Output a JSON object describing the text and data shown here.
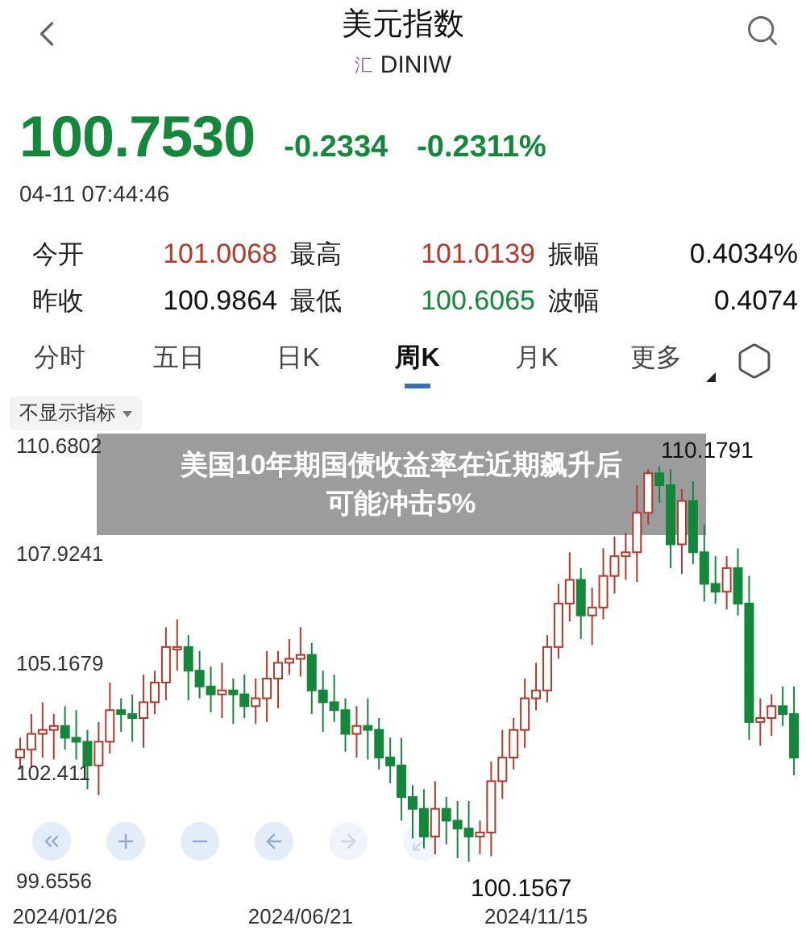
{
  "header": {
    "title": "美元指数",
    "market_tag": "汇",
    "code": "DINIW"
  },
  "quote": {
    "price": "100.7530",
    "change": "-0.2334",
    "change_pct": "-0.2311%",
    "time": "04-11 07:44:46",
    "color": "#14883a"
  },
  "stats": [
    {
      "label": "今开",
      "value": "101.0068",
      "color": "#b5382b"
    },
    {
      "label": "最高",
      "value": "101.0139",
      "color": "#b5382b"
    },
    {
      "label": "振幅",
      "value": "0.4034%",
      "color": "#111111"
    },
    {
      "label": "昨收",
      "value": "100.9864",
      "color": "#111111"
    },
    {
      "label": "最低",
      "value": "100.6065",
      "color": "#14883a"
    },
    {
      "label": "波幅",
      "value": "0.4074",
      "color": "#111111"
    }
  ],
  "tabs": [
    {
      "label": "分时",
      "selected": false
    },
    {
      "label": "五日",
      "selected": false
    },
    {
      "label": "日K",
      "selected": false
    },
    {
      "label": "周K",
      "selected": true
    },
    {
      "label": "月K",
      "selected": false
    },
    {
      "label": "更多",
      "selected": false
    }
  ],
  "indicator_selector": {
    "label": "不显示指标"
  },
  "chart": {
    "high_label": "110.1791",
    "low_label": "100.1567",
    "chart_data": {
      "type": "candlestick",
      "ylim": [
        99.6556,
        110.6802
      ],
      "yticks": [
        {
          "value": 110.6802,
          "label": "110.6802"
        },
        {
          "value": 107.9241,
          "label": "107.9241"
        },
        {
          "value": 105.1679,
          "label": "105.1679"
        },
        {
          "value": 102.411,
          "label": "102.411"
        },
        {
          "value": 99.6556,
          "label": "99.6556"
        }
      ],
      "categories": [
        null,
        null,
        null,
        null,
        "2024/01/26",
        null,
        null,
        null,
        null,
        null,
        null,
        null,
        null,
        null,
        null,
        null,
        null,
        null,
        null,
        null,
        null,
        null,
        null,
        null,
        null,
        "2024/06/21",
        null,
        null,
        null,
        null,
        null,
        null,
        null,
        null,
        null,
        null,
        null,
        null,
        null,
        null,
        null,
        null,
        null,
        null,
        null,
        null,
        "2024/11/15",
        null,
        null,
        null,
        null,
        null,
        null,
        null,
        null,
        null,
        null,
        null,
        null,
        null,
        null,
        null,
        null,
        null,
        null,
        null,
        null,
        null,
        null,
        null
      ],
      "ohlc": [
        [
          102.8,
          103.3,
          102.5,
          103.0
        ],
        [
          103.0,
          103.9,
          102.55,
          103.4
        ],
        [
          103.4,
          104.2,
          102.8,
          103.5
        ],
        [
          103.5,
          103.9,
          102.75,
          103.6
        ],
        [
          103.6,
          104.1,
          103.0,
          103.3
        ],
        [
          103.3,
          104.0,
          102.75,
          103.2
        ],
        [
          103.2,
          103.5,
          102.0,
          102.6
        ],
        [
          102.6,
          103.7,
          101.85,
          103.2
        ],
        [
          103.2,
          104.7,
          102.9,
          104.0
        ],
        [
          104.0,
          104.3,
          103.45,
          103.9
        ],
        [
          103.9,
          104.4,
          103.2,
          103.8
        ],
        [
          103.8,
          104.9,
          103.05,
          104.2
        ],
        [
          104.2,
          105.0,
          103.9,
          104.7
        ],
        [
          104.7,
          106.1,
          104.25,
          105.6
        ],
        [
          105.6,
          106.3,
          105.0,
          105.6
        ],
        [
          105.6,
          105.9,
          104.25,
          105.0
        ],
        [
          105.0,
          105.5,
          104.3,
          104.6
        ],
        [
          104.6,
          105.1,
          103.95,
          104.4
        ],
        [
          104.4,
          105.2,
          103.8,
          104.5
        ],
        [
          104.5,
          104.8,
          103.65,
          104.4
        ],
        [
          104.4,
          104.9,
          103.8,
          104.1
        ],
        [
          104.1,
          104.8,
          103.65,
          104.3
        ],
        [
          104.3,
          105.5,
          103.7,
          104.8
        ],
        [
          104.8,
          105.5,
          104.05,
          105.2
        ],
        [
          105.2,
          105.8,
          104.9,
          105.3
        ],
        [
          105.3,
          106.1,
          104.85,
          105.4
        ],
        [
          105.4,
          105.7,
          103.9,
          104.5
        ],
        [
          104.5,
          105.0,
          103.45,
          104.2
        ],
        [
          104.2,
          104.9,
          103.7,
          104.0
        ],
        [
          104.0,
          104.3,
          102.95,
          103.4
        ],
        [
          103.4,
          104.1,
          102.8,
          103.6
        ],
        [
          103.6,
          104.3,
          102.75,
          103.5
        ],
        [
          103.5,
          103.8,
          102.5,
          102.8
        ],
        [
          102.8,
          103.3,
          102.15,
          102.6
        ],
        [
          102.6,
          103.3,
          101.2,
          101.8
        ],
        [
          101.8,
          102.1,
          100.75,
          101.5
        ],
        [
          101.5,
          102.0,
          100.5,
          100.8
        ],
        [
          100.8,
          102.2,
          100.35,
          101.5
        ],
        [
          101.5,
          101.8,
          100.6,
          101.2
        ],
        [
          101.2,
          101.7,
          100.25,
          101.0
        ],
        [
          101.0,
          101.7,
          100.16,
          100.8
        ],
        [
          100.8,
          101.2,
          100.35,
          100.9
        ],
        [
          100.9,
          102.7,
          100.3,
          102.2
        ],
        [
          102.2,
          103.5,
          101.75,
          102.8
        ],
        [
          102.8,
          103.8,
          102.5,
          103.5
        ],
        [
          103.5,
          104.8,
          103.05,
          104.3
        ],
        [
          104.3,
          105.2,
          104.0,
          104.5
        ],
        [
          104.5,
          105.9,
          104.2,
          105.6
        ],
        [
          105.6,
          107.2,
          105.3,
          106.7
        ],
        [
          106.7,
          108.0,
          106.25,
          107.3
        ],
        [
          107.3,
          107.6,
          105.8,
          106.4
        ],
        [
          106.4,
          107.1,
          105.65,
          106.6
        ],
        [
          106.6,
          108.1,
          106.3,
          107.4
        ],
        [
          107.4,
          108.4,
          106.95,
          107.9
        ],
        [
          107.9,
          108.5,
          107.3,
          108.0
        ],
        [
          108.0,
          109.7,
          107.25,
          109.0
        ],
        [
          109.0,
          110.1,
          108.7,
          110.0
        ],
        [
          110.0,
          110.18,
          109.25,
          109.7
        ],
        [
          109.7,
          110.1,
          107.6,
          108.2
        ],
        [
          108.2,
          109.6,
          107.45,
          109.3
        ],
        [
          109.3,
          109.8,
          107.7,
          108.0
        ],
        [
          108.0,
          108.7,
          106.75,
          107.2
        ],
        [
          107.2,
          107.9,
          106.7,
          107.0
        ],
        [
          107.0,
          107.9,
          106.55,
          107.6
        ],
        [
          107.6,
          108.1,
          106.4,
          106.7
        ],
        [
          106.7,
          107.4,
          103.25,
          103.7
        ],
        [
          103.7,
          104.3,
          103.1,
          103.8
        ],
        [
          103.8,
          104.4,
          103.35,
          104.1
        ],
        [
          104.1,
          104.6,
          103.6,
          103.9
        ],
        [
          103.9,
          104.6,
          102.35,
          102.8
        ]
      ]
    },
    "controls": [
      {
        "kind": "rewind",
        "disabled": false
      },
      {
        "kind": "zoom-in",
        "disabled": false
      },
      {
        "kind": "zoom-out",
        "disabled": false
      },
      {
        "kind": "left",
        "disabled": false
      },
      {
        "kind": "right",
        "disabled": true
      },
      {
        "kind": "fullscreen",
        "disabled": true
      }
    ]
  },
  "caption": {
    "lines": [
      "美国10年期国债收益率在近期飙升后",
      "可能冲击5%"
    ]
  }
}
